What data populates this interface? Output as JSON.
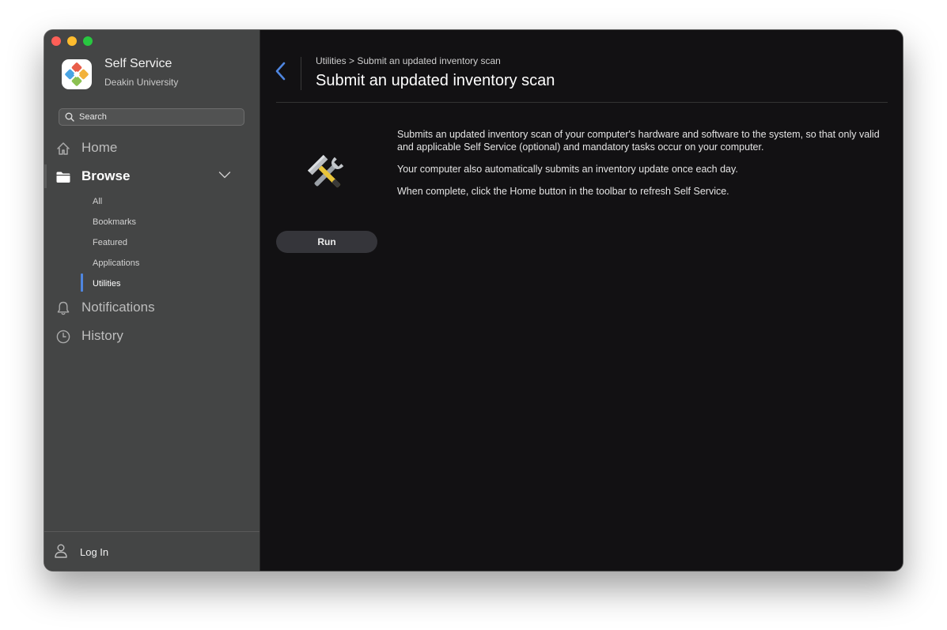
{
  "window": {
    "controls": [
      "close",
      "minimize",
      "zoom"
    ]
  },
  "app": {
    "title": "Self Service",
    "organization": "Deakin University",
    "icon": "self-service-app-icon"
  },
  "search": {
    "placeholder": "Search",
    "value": ""
  },
  "sidebar": {
    "nav": [
      {
        "label": "Home",
        "icon": "home-icon"
      },
      {
        "label": "Browse",
        "icon": "folder-icon",
        "expanded": true
      },
      {
        "label": "Notifications",
        "icon": "bell-icon"
      },
      {
        "label": "History",
        "icon": "clock-icon"
      }
    ],
    "browse_items": [
      {
        "label": "All"
      },
      {
        "label": "Bookmarks"
      },
      {
        "label": "Featured"
      },
      {
        "label": "Applications"
      },
      {
        "label": "Utilities",
        "active": true
      }
    ],
    "login": {
      "label": "Log In",
      "icon": "person-icon"
    },
    "accent_color": "#4f86e0"
  },
  "main": {
    "breadcrumb": "Utilities > Submit an updated inventory scan",
    "title": "Submit an updated inventory scan",
    "item_icon": "hammer-wrench-icon",
    "run_label": "Run",
    "description": [
      "Submits an updated inventory scan of your computer's hardware and software to the system, so that only valid and applicable Self Service (optional) and mandatory tasks occur on your computer.",
      "Your computer also automatically submits an inventory update once each day.",
      "When complete, click the Home button in the toolbar to refresh Self Service."
    ]
  }
}
